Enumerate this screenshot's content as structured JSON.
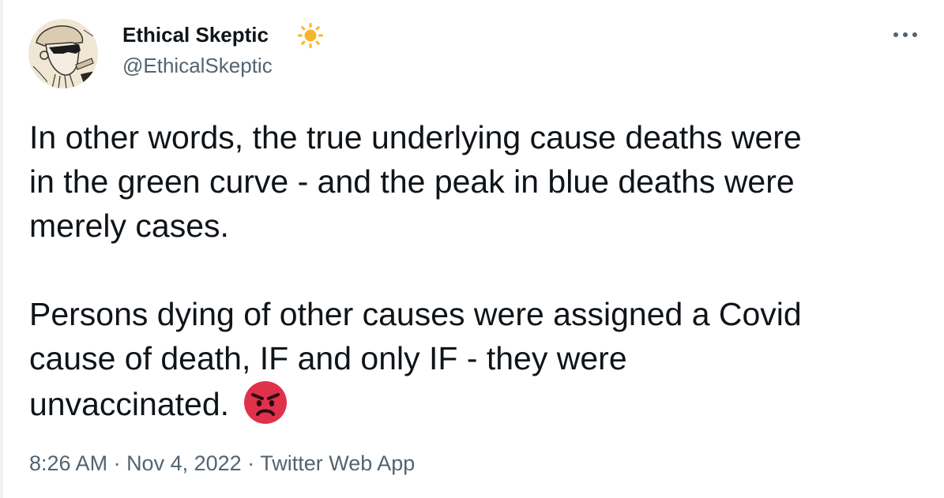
{
  "author": {
    "name": "Ethical Skeptic",
    "handle": "@EthicalSkeptic",
    "badge_icon": "sun-emoji-icon",
    "avatar_icon": "sketched-face-with-sunglasses-avatar"
  },
  "menu": {
    "more_icon": "ellipsis-icon"
  },
  "tweet": {
    "paragraph_1": {
      "line_1": "In other words, the true underlying cause deaths were",
      "line_2": "in the green curve - and the peak in blue deaths were",
      "line_3": "merely cases."
    },
    "paragraph_2": {
      "line_1": "Persons dying of other causes were assigned a Covid",
      "line_2": "cause of death, IF and only IF - they were",
      "line_3": "unvaccinated."
    },
    "emoji": "angry-face-icon"
  },
  "meta": {
    "time": "8:26 AM",
    "separator_1": " · ",
    "date": "Nov 4, 2022",
    "separator_2": " · ",
    "source": "Twitter Web App"
  },
  "colors": {
    "text_primary": "#0f1419",
    "text_secondary": "#536471",
    "sun": "#f7b52c",
    "angry_face": "#e0314b",
    "border": "#eff3f4"
  }
}
